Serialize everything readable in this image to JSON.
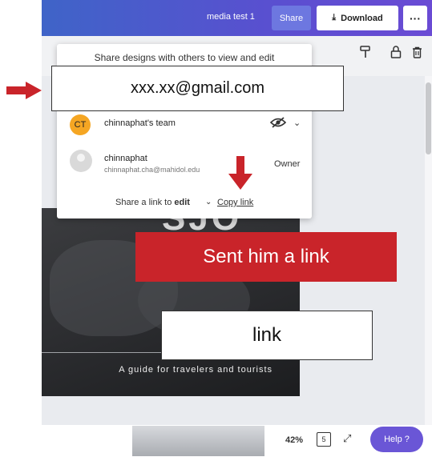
{
  "header": {
    "doc_title": "media test 1",
    "share_label": "Share",
    "download_label": "Download",
    "more_label": "···"
  },
  "toolbar": {
    "icons": [
      "paint-roller-icon",
      "lock-icon",
      "trash-icon"
    ]
  },
  "share_panel": {
    "title": "Share designs with others to view and edit",
    "email_value": "xxx.xx@gmail.com",
    "members": [
      {
        "avatar": "CT",
        "name": "chinnaphat's team",
        "email": "",
        "role": ""
      },
      {
        "avatar": "",
        "name": "chinnaphat",
        "email": "chinnaphat.cha@mahidol.edu",
        "role": "Owner"
      }
    ],
    "share_link_prefix": "Share a link to",
    "share_link_mode": "edit",
    "copy_link_label": "Copy link"
  },
  "design": {
    "big_text": "SJO",
    "subtitle": "A guide for travelers and tourists"
  },
  "annotations": {
    "sent_label": "Sent him a link",
    "link_label": "link",
    "accent_color": "#c9242a"
  },
  "footer": {
    "zoom": "42%",
    "pages": "5",
    "help_label": "Help ?"
  }
}
